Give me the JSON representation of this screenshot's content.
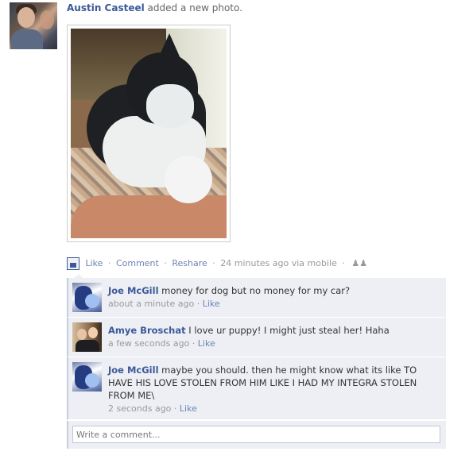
{
  "story": {
    "actor": "Austin Casteel",
    "verb": "added a new photo."
  },
  "actions": {
    "like": "Like",
    "comment": "Comment",
    "reshare": "Reshare",
    "time": "24 minutes ago via mobile",
    "sep": "·"
  },
  "comments": [
    {
      "name": "Joe McGill",
      "text": "money for dog but no money for my car?",
      "time": "about a minute ago",
      "like": "Like"
    },
    {
      "name": "Amye Broschat",
      "text": "I love ur puppy! I might just steal her! Haha",
      "time": "a few seconds ago",
      "like": "Like"
    },
    {
      "name": "Joe McGill",
      "text": "maybe you should. then he might know what its like TO HAVE HIS LOVE STOLEN FROM HIM LIKE I HAD MY INTEGRA STOLEN FROM ME\\",
      "time": "2 seconds ago",
      "like": "Like"
    }
  ],
  "composer": {
    "placeholder": "Write a comment..."
  },
  "icons": {
    "feed": "mobile-upload-icon",
    "privacy": "people-icon"
  }
}
